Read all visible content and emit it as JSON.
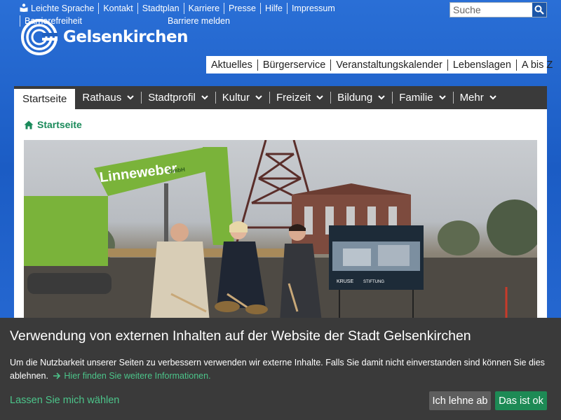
{
  "colors": {
    "header_blue": "#1f5fbf",
    "nav_dark": "#3a3a3a",
    "accent_green": "#1a8a5a",
    "link_green": "#4cc48a",
    "accept_green": "#1d8a55"
  },
  "header": {
    "utility_links": [
      {
        "label": "Leichte Sprache",
        "icon": "easy-language-icon"
      },
      {
        "label": "Kontakt"
      },
      {
        "label": "Stadtplan"
      },
      {
        "label": "Karriere"
      },
      {
        "label": "Presse"
      },
      {
        "label": "Hilfe"
      },
      {
        "label": "Impressum"
      },
      {
        "label": "Barrierefreiheit"
      },
      {
        "label": "Barriere melden"
      }
    ],
    "search": {
      "placeholder": "Suche",
      "icon": "search-icon"
    },
    "logo_text": "Gelsenkirchen"
  },
  "service_nav": [
    "Aktuelles",
    "Bürgerservice",
    "Veranstaltungskalender",
    "Lebenslagen",
    "A bis Z"
  ],
  "main_nav": [
    {
      "label": "Startseite",
      "active": true,
      "dropdown": false
    },
    {
      "label": "Rathaus",
      "dropdown": true
    },
    {
      "label": "Stadtprofil",
      "dropdown": true
    },
    {
      "label": "Kultur",
      "dropdown": true
    },
    {
      "label": "Freizeit",
      "dropdown": true
    },
    {
      "label": "Bildung",
      "dropdown": true
    },
    {
      "label": "Familie",
      "dropdown": true
    },
    {
      "label": "Mehr",
      "dropdown": true
    }
  ],
  "breadcrumb": {
    "label": "Startseite",
    "icon": "home-icon"
  },
  "hero": {
    "excavator_brand": "Linneweber",
    "excavator_brand_suffix": "GmbH",
    "sign_brands": [
      "KRUSE",
      "STIFTUNG"
    ]
  },
  "cookie_banner": {
    "title": "Verwendung von externen Inhalten auf der Website der Stadt Gelsenkirchen",
    "text": "Um die Nutzbarkeit unserer Seiten zu verbessern verwenden wir externe Inhalte. Falls Sie damit nicht einverstanden sind können Sie dies ablehnen.",
    "more_link": "Hier finden Sie weitere Informationen.",
    "choose_link": "Lassen Sie mich wählen",
    "decline_button": "Ich lehne ab",
    "accept_button": "Das ist ok"
  }
}
